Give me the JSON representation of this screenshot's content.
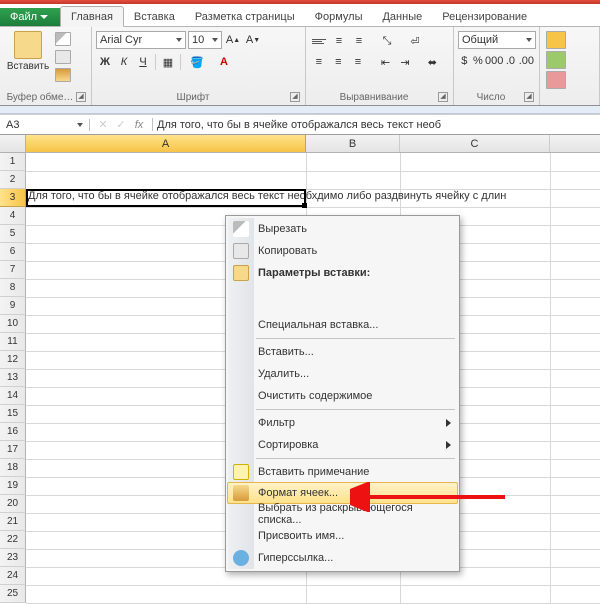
{
  "tabs": {
    "file": "Файл",
    "items": [
      "Главная",
      "Вставка",
      "Разметка страницы",
      "Формулы",
      "Данные",
      "Рецензирование"
    ],
    "active_index": 0
  },
  "ribbon": {
    "clipboard": {
      "label": "Буфер обме…",
      "paste": "Вставить"
    },
    "font": {
      "label": "Шрифт",
      "name": "Arial Cyr",
      "size": "10",
      "bold": "Ж",
      "italic": "К",
      "underline": "Ч"
    },
    "alignment": {
      "label": "Выравнивание"
    },
    "number": {
      "label": "Число",
      "format": "Общий"
    }
  },
  "formula_bar": {
    "cell_ref": "A3",
    "fx": "fx",
    "content": "Для того, что бы в ячейке отображался весь текст необ"
  },
  "grid": {
    "columns": [
      "A",
      "B",
      "C"
    ],
    "rows": [
      "1",
      "2",
      "3",
      "4",
      "5",
      "6",
      "7",
      "8",
      "9",
      "10",
      "11",
      "12",
      "13",
      "14",
      "15",
      "16",
      "17",
      "18",
      "19",
      "20",
      "21",
      "22",
      "23",
      "24",
      "25"
    ],
    "selected_row": "3",
    "a3_text": "Для того, что бы в ячейке отображался весь текст необхдимо либо раздвинуть ячейку с длин"
  },
  "context_menu": {
    "cut": "Вырезать",
    "copy": "Копировать",
    "paste_opts_hdr": "Параметры вставки:",
    "paste_special": "Специальная вставка...",
    "insert": "Вставить...",
    "delete": "Удалить...",
    "clear": "Очистить содержимое",
    "filter": "Фильтр",
    "sort": "Сортировка",
    "comment": "Вставить примечание",
    "format_cells": "Формат ячеек...",
    "dropdown": "Выбрать из раскрывающегося списка...",
    "define_name": "Присвоить имя...",
    "hyperlink": "Гиперссылка..."
  }
}
